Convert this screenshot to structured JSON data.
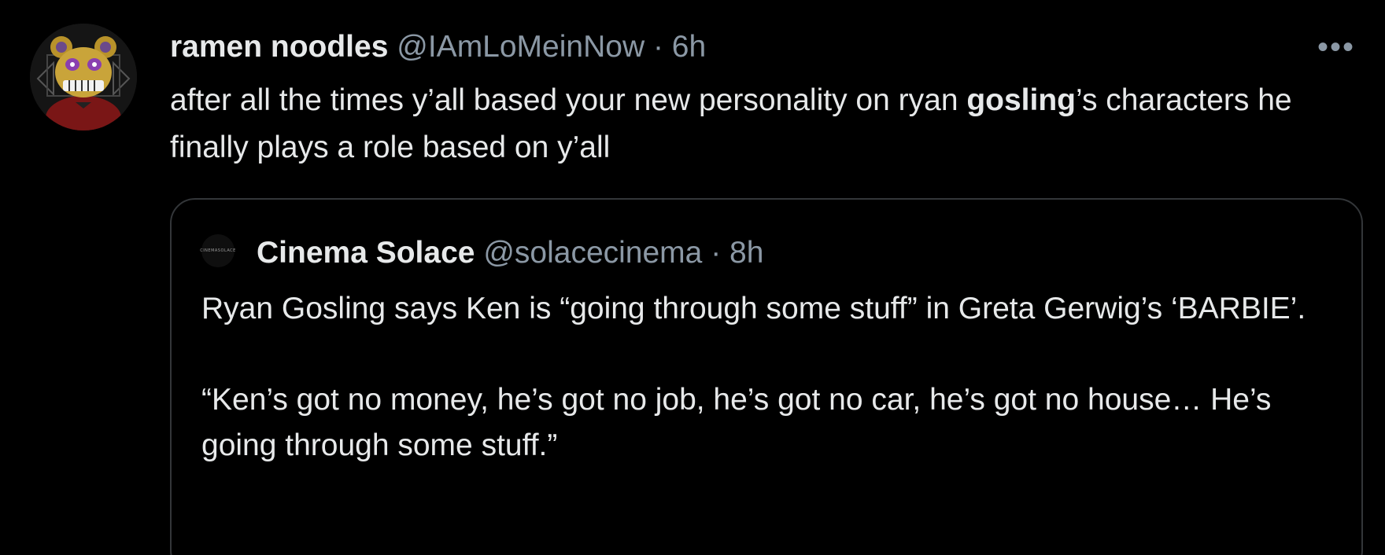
{
  "tweet": {
    "display_name": "ramen noodles",
    "handle": "@IAmLoMeinNow",
    "separator": "·",
    "time": "6h",
    "more_label": "•••",
    "text_before": "after all the times y’all based your new personality on ryan ",
    "text_bold": "gosling",
    "text_after": "’s characters he finally plays a role based on y’all",
    "avatar_icon": "bear-animatronic-avatar"
  },
  "quoted_tweet": {
    "display_name": "Cinema Solace",
    "handle": "@solacecinema",
    "separator": "·",
    "time": "8h",
    "avatar_text": "CINEMASOLACE",
    "paragraph_1": "Ryan Gosling says Ken is “going through some stuff” in Greta Gerwig’s ‘BARBIE’.",
    "paragraph_2": "“Ken’s got no money, he’s got no job, he’s got no car, he’s got no house… He’s going through some stuff.”"
  },
  "colors": {
    "background": "#000000",
    "primary_text": "#e7e9ea",
    "secondary_text": "#8b98a5",
    "border": "#333639"
  }
}
